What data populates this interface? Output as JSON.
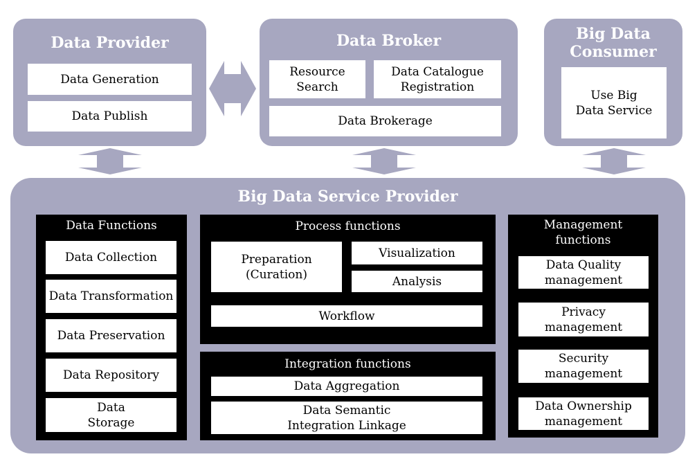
{
  "colors": {
    "panel": "#a7a7c0",
    "function_box": "#000000",
    "item": "#ffffff"
  },
  "data_provider": {
    "title": "Data Provider",
    "items": [
      "Data Generation",
      "Data Publish"
    ]
  },
  "data_broker": {
    "title": "Data Broker",
    "items": [
      "Resource Search",
      "Data Catalogue Registration",
      "Data Brokerage"
    ]
  },
  "consumer": {
    "title": "Big Data Consumer",
    "items": [
      "Use Big Data Service"
    ]
  },
  "service_provider": {
    "title": "Big Data Service Provider",
    "data_functions": {
      "title": "Data Functions",
      "items": [
        "Data Collection",
        "Data Transformation",
        "Data Preservation",
        "Data Repository",
        "Data Storage"
      ]
    },
    "process_functions": {
      "title": "Process functions",
      "items": [
        "Preparation (Curation)",
        "Visualization",
        "Analysis",
        "Workflow"
      ]
    },
    "integration_functions": {
      "title": "Integration functions",
      "items": [
        "Data Aggregation",
        "Data Semantic Integration Linkage"
      ]
    },
    "management_functions": {
      "title": "Management functions",
      "items": [
        "Data Quality management",
        "Privacy management",
        "Security management",
        "Data Ownership management"
      ]
    }
  }
}
